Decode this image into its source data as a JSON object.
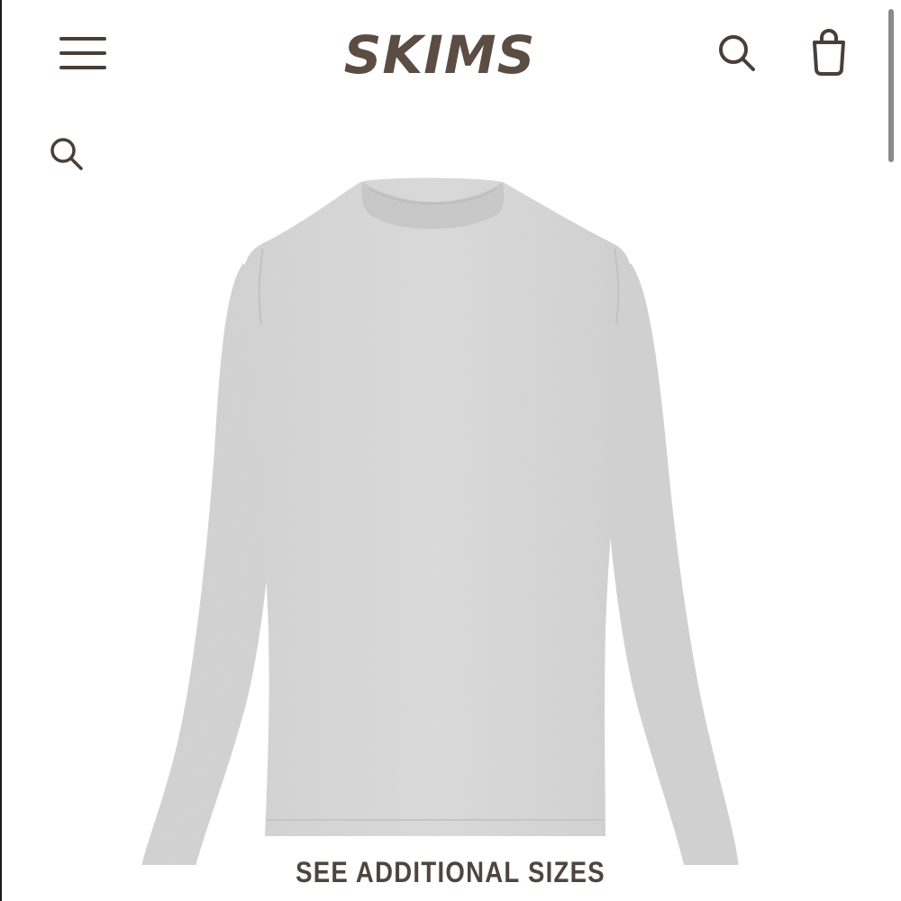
{
  "header": {
    "logo_text": "SKIMS",
    "icons": {
      "menu": "hamburger-menu-icon",
      "search": "search-icon",
      "bag": "shopping-bag-icon"
    }
  },
  "secondary_search": {
    "icon": "search-icon"
  },
  "product": {
    "image_alt": "Gray heather long sleeve crewneck top"
  },
  "footer_link": {
    "label": "SEE ADDITIONAL SIZES"
  },
  "colors": {
    "brand": "#5b4d43",
    "icon": "#4a3f38",
    "garment": "#d3d3d3",
    "background": "#ffffff"
  }
}
